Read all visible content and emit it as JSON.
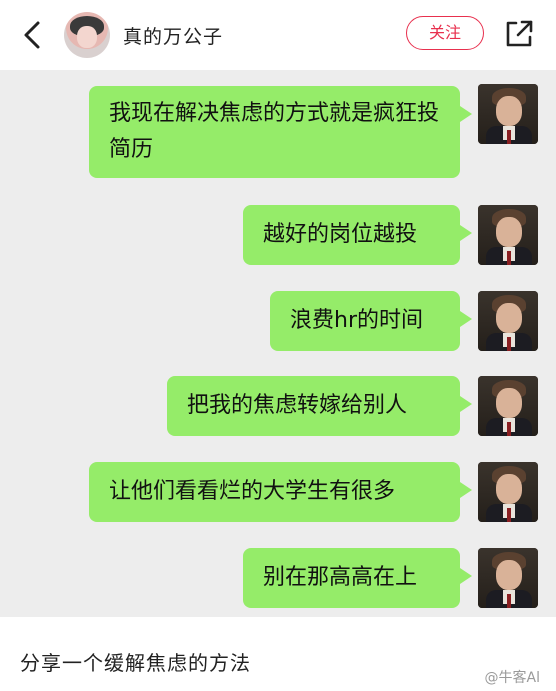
{
  "header": {
    "back_icon": "chevron-left-icon",
    "username": "真的万公子",
    "follow_label": "关注",
    "share_icon": "external-link-icon"
  },
  "messages": [
    {
      "text": "我现在解决焦虑的方式就是疯狂投简历"
    },
    {
      "text": "越好的岗位越投"
    },
    {
      "text": "浪费hr的时间"
    },
    {
      "text": "把我的焦虑转嫁给别人"
    },
    {
      "text": "让他们看看烂的大学生有很多"
    },
    {
      "text": "别在那高高在上"
    }
  ],
  "footer": {
    "caption": "分享一个缓解焦虑的方法",
    "watermark": "@牛客Al"
  },
  "colors": {
    "bubble": "#95ec69",
    "chat_bg": "#ededed",
    "follow_accent": "#e8304e"
  }
}
